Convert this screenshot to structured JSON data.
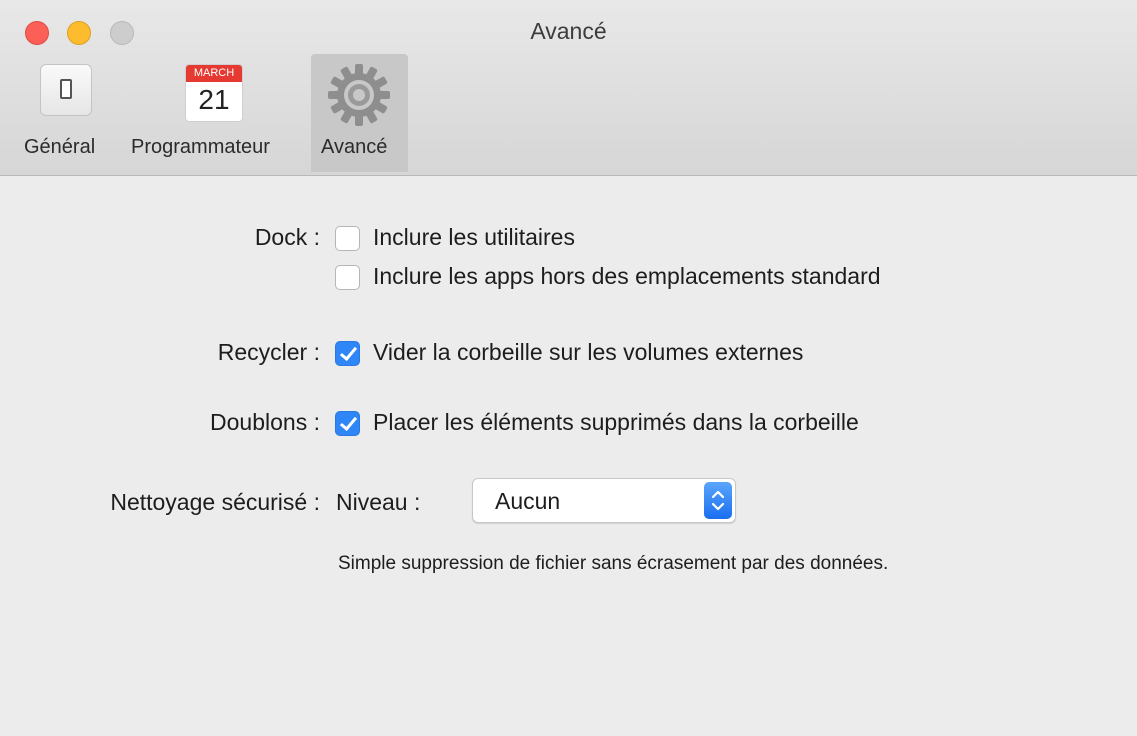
{
  "window": {
    "title": "Avancé"
  },
  "toolbar": {
    "tabs": [
      {
        "label": "Général",
        "icon": "general-switch-icon"
      },
      {
        "label": "Programmateur",
        "icon": "calendar-icon",
        "calendar_month": "MARCH",
        "calendar_day": "21"
      },
      {
        "label": "Avancé",
        "icon": "gear-icon",
        "active": true
      }
    ]
  },
  "settings": {
    "dock": {
      "label": "Dock :",
      "options": [
        {
          "label": "Inclure les utilitaires",
          "checked": false
        },
        {
          "label": "Inclure les apps hors des emplacements standard",
          "checked": false
        }
      ]
    },
    "recycler": {
      "label": "Recycler :",
      "option": {
        "label": "Vider la corbeille sur les volumes externes",
        "checked": true
      }
    },
    "doublons": {
      "label": "Doublons :",
      "option": {
        "label": "Placer les éléments supprimés dans la corbeille",
        "checked": true
      }
    },
    "secure_clean": {
      "label": "Nettoyage sécurisé :",
      "level_label": "Niveau :",
      "level_value": "Aucun",
      "description": "Simple suppression de fichier sans écrasement par des données."
    }
  },
  "colors": {
    "accent": "#2f86f7",
    "close": "#fc5f57",
    "minimize": "#fdbc2e",
    "zoom": "#cdcdcd"
  }
}
